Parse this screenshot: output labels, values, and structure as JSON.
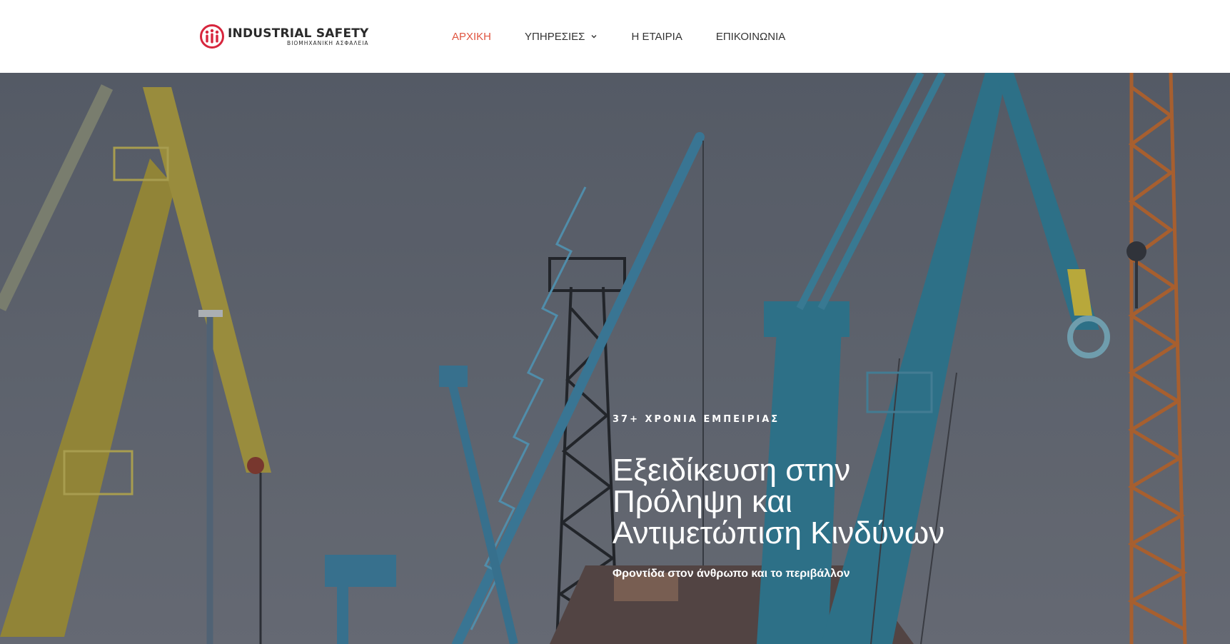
{
  "header": {
    "logo": {
      "title": "INDUSTRIAL SAFETY",
      "subtitle": "ΒΙΟΜΗΧΑΝΙΚΗ ΑΣΦΑΛΕΙΑ",
      "icon": "people-circle-icon",
      "brand_color": "#d7263d"
    },
    "nav": [
      {
        "label": "ΑΡΧΙΚΗ",
        "active": true
      },
      {
        "label": "ΥΠΗΡΕΣΙΕΣ",
        "has_dropdown": true,
        "dropdown_icon": "chevron-down-icon"
      },
      {
        "label": "Η ΕΤΑΙΡΙΑ"
      },
      {
        "label": "ΕΠΙΚΟΙΝΩΝΙΑ"
      }
    ],
    "active_color": "#e05540"
  },
  "hero": {
    "eyebrow": "37+ ΧΡΟΝΙΑ ΕΜΠΕΙΡΙΑΣ",
    "headline": "Εξειδίκευση στην Πρόληψη και Αντιμετώπιση Κινδύνων",
    "tagline": "Φροντίδα στον άνθρωπο και το περιβάλλον",
    "background": "port-cranes-image"
  }
}
